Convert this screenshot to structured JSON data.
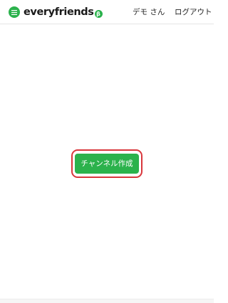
{
  "header": {
    "logo_text": "everyfriends",
    "logo_badge": "β",
    "user_name": "デモ さん",
    "logout_label": "ログアウト"
  },
  "main": {
    "create_channel_label": "チャンネル作成"
  },
  "colors": {
    "brand_green": "#2bb24c",
    "highlight_red": "#d9373c"
  },
  "icons": {
    "menu": "hamburger-menu-icon"
  }
}
